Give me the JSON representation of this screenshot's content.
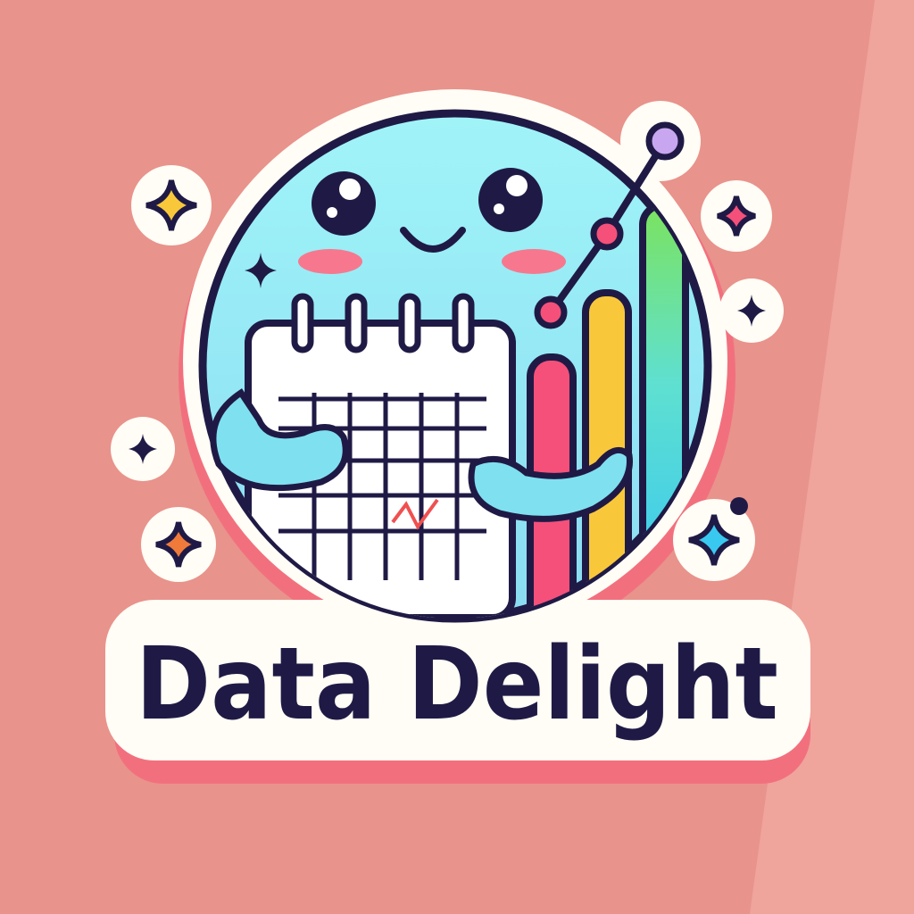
{
  "logo": {
    "text": "Data Delight",
    "colors": {
      "background": "#E8938C",
      "background_stripe": "#EFA49C",
      "face": "#93E9F4",
      "outline": "#1F1A45",
      "blush": "#F7788E",
      "bar_pink": "#F5507A",
      "bar_yellow": "#F9C83A",
      "bar_green_blue": "#6FE37A",
      "sticker_shadow": "#F2707E"
    }
  }
}
